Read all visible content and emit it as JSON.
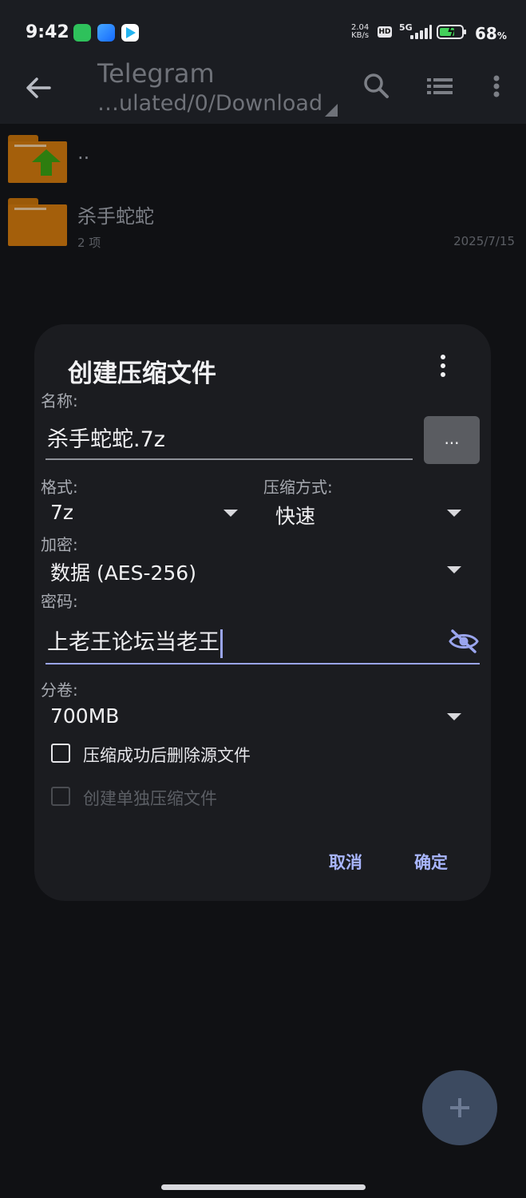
{
  "status_bar": {
    "time": "9:42",
    "net_speed_value": "2.04",
    "net_speed_unit": "KB/s",
    "hd_label": "HD",
    "network_type": "5G",
    "battery_percent": "68",
    "battery_unit": "%"
  },
  "app_bar": {
    "title": "Telegram",
    "path": "…ulated/0/Download"
  },
  "file_list": [
    {
      "name": "..",
      "meta": "",
      "date": ""
    },
    {
      "name": "杀手蛇蛇",
      "meta": "2 项",
      "date": "2025/7/15"
    }
  ],
  "dialog": {
    "title": "创建压缩文件",
    "name_label": "名称:",
    "name_value": "杀手蛇蛇.7z",
    "browse_label": "...",
    "format_label": "格式:",
    "format_value": "7z",
    "method_label": "压缩方式:",
    "method_value": "快速",
    "encryption_label": "加密:",
    "encryption_value": "数据 (AES-256)",
    "password_label": "密码:",
    "password_value": "上老王论坛当老王",
    "split_label": "分卷:",
    "split_value": "700MB",
    "delete_source_label": "压缩成功后删除源文件",
    "separate_archives_label": "创建单独压缩文件",
    "cancel_label": "取消",
    "ok_label": "确定"
  },
  "colors": {
    "accent": "#a9b6ff",
    "folder": "#a45f0b",
    "dialog_bg": "#1b1c20"
  }
}
